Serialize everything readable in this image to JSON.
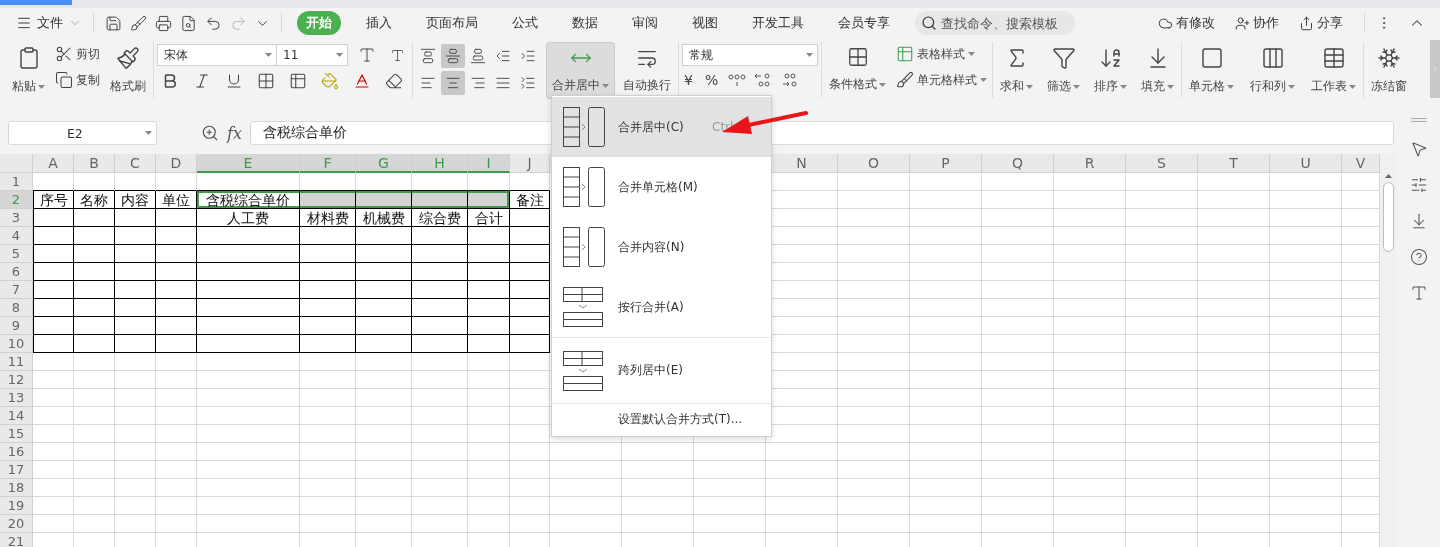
{
  "file_menu": {
    "label": "文件"
  },
  "tabs": [
    {
      "label": "开始",
      "selected": true
    },
    {
      "label": "插入",
      "selected": false
    },
    {
      "label": "页面布局",
      "selected": false
    },
    {
      "label": "公式",
      "selected": false
    },
    {
      "label": "数据",
      "selected": false
    },
    {
      "label": "审阅",
      "selected": false
    },
    {
      "label": "视图",
      "selected": false
    },
    {
      "label": "开发工具",
      "selected": false
    },
    {
      "label": "会员专享",
      "selected": false
    }
  ],
  "search": {
    "placeholder": "查找命令、搜索模板"
  },
  "header_actions": [
    {
      "label": "有修改",
      "kind": "cloud"
    },
    {
      "label": "协作",
      "kind": "user"
    },
    {
      "label": "分享",
      "kind": "share"
    }
  ],
  "ribbon": {
    "paste": "粘贴",
    "cut": "剪切",
    "copy": "复制",
    "format_painter": "格式刷",
    "font_name": "宋体",
    "font_size": "11",
    "align_top_row": [
      {
        "selected": false
      },
      {
        "selected": true
      },
      {
        "selected": false
      },
      {
        "selected": false
      },
      {
        "selected": false
      }
    ],
    "align_bottom_row": [
      {
        "selected": false
      },
      {
        "selected": true
      },
      {
        "selected": false
      },
      {
        "selected": false
      },
      {
        "selected": false
      }
    ],
    "merge": {
      "label": "合并居中",
      "expanded": true
    },
    "wrap": "自动换行",
    "number_format": "常规",
    "number_buttons": [
      "¥",
      "%"
    ],
    "conditional_format": "条件格式",
    "table_style": "表格样式",
    "cell_style": "单元格样式",
    "big_buttons": [
      {
        "label": "求和",
        "kind": "sum"
      },
      {
        "label": "筛选",
        "kind": "filter"
      },
      {
        "label": "排序",
        "kind": "sort"
      },
      {
        "label": "填充",
        "kind": "fill"
      }
    ],
    "cell_buttons": [
      {
        "label": "单元格",
        "kind": "cell"
      },
      {
        "label": "行和列",
        "kind": "rowcol"
      },
      {
        "label": "工作表",
        "kind": "sheet"
      }
    ],
    "freeze": "冻结窗"
  },
  "name_box": "E2",
  "function_label": "fx",
  "formula": "含税综合单价",
  "columns": [
    {
      "label": "A",
      "selected": false
    },
    {
      "label": "B",
      "selected": false
    },
    {
      "label": "C",
      "selected": false
    },
    {
      "label": "D",
      "selected": false
    },
    {
      "label": "E",
      "selected": true
    },
    {
      "label": "F",
      "selected": true
    },
    {
      "label": "G",
      "selected": true
    },
    {
      "label": "H",
      "selected": true
    },
    {
      "label": "I",
      "selected": true
    },
    {
      "label": "J",
      "selected": false
    },
    {
      "label": "N",
      "selected": false
    },
    {
      "label": "O",
      "selected": false
    },
    {
      "label": "P",
      "selected": false
    },
    {
      "label": "Q",
      "selected": false
    },
    {
      "label": "R",
      "selected": false
    },
    {
      "label": "S",
      "selected": false
    },
    {
      "label": "T",
      "selected": false
    },
    {
      "label": "U",
      "selected": false
    },
    {
      "label": "V",
      "selected": false
    }
  ],
  "rows": [
    {
      "label": "1",
      "selected": false,
      "bordered": false
    },
    {
      "label": "2",
      "selected": true,
      "bordered": true,
      "cells": [
        "序号",
        "名称",
        "内容",
        "单位",
        "含税综合单价",
        null,
        null,
        null,
        null,
        "备注"
      ]
    },
    {
      "label": "3",
      "selected": false,
      "bordered": true,
      "cells": [
        null,
        null,
        null,
        null,
        "人工费",
        "材料费",
        "机械费",
        "综合费",
        "合计",
        null
      ]
    },
    {
      "label": "4",
      "selected": false,
      "bordered": true
    },
    {
      "label": "5",
      "selected": false,
      "bordered": true
    },
    {
      "label": "6",
      "selected": false,
      "bordered": true
    },
    {
      "label": "7",
      "selected": false,
      "bordered": true
    },
    {
      "label": "8",
      "selected": false,
      "bordered": true
    },
    {
      "label": "9",
      "selected": false,
      "bordered": true
    },
    {
      "label": "10",
      "selected": false,
      "bordered": true
    },
    {
      "label": "11",
      "selected": false,
      "bordered": false
    },
    {
      "label": "12",
      "selected": false,
      "bordered": false
    },
    {
      "label": "13",
      "selected": false,
      "bordered": false
    },
    {
      "label": "14",
      "selected": false,
      "bordered": false
    },
    {
      "label": "15",
      "selected": false,
      "bordered": false
    },
    {
      "label": "16",
      "selected": false,
      "bordered": false
    },
    {
      "label": "17",
      "selected": false,
      "bordered": false
    },
    {
      "label": "18",
      "selected": false,
      "bordered": false
    },
    {
      "label": "19",
      "selected": false,
      "bordered": false
    },
    {
      "label": "20",
      "selected": false,
      "bordered": false
    },
    {
      "label": "21",
      "selected": false,
      "bordered": false
    }
  ],
  "merge_menu": {
    "items": [
      {
        "label": "合并居中(C)",
        "kind": "center",
        "shortcut": "Ctrl",
        "selected": true
      },
      {
        "label": "合并单元格(M)",
        "kind": "cells",
        "selected": false
      },
      {
        "label": "合并内容(N)",
        "kind": "content",
        "selected": false
      },
      {
        "label": "按行合并(A)",
        "kind": "rows",
        "selected": false
      },
      {
        "label": "跨列居中(E)",
        "kind": "across",
        "selected": false
      },
      {
        "label": "设置默认合并方式(T)...",
        "kind": "setting",
        "selected": false
      }
    ]
  },
  "annotation": {
    "kind": "arrow"
  }
}
